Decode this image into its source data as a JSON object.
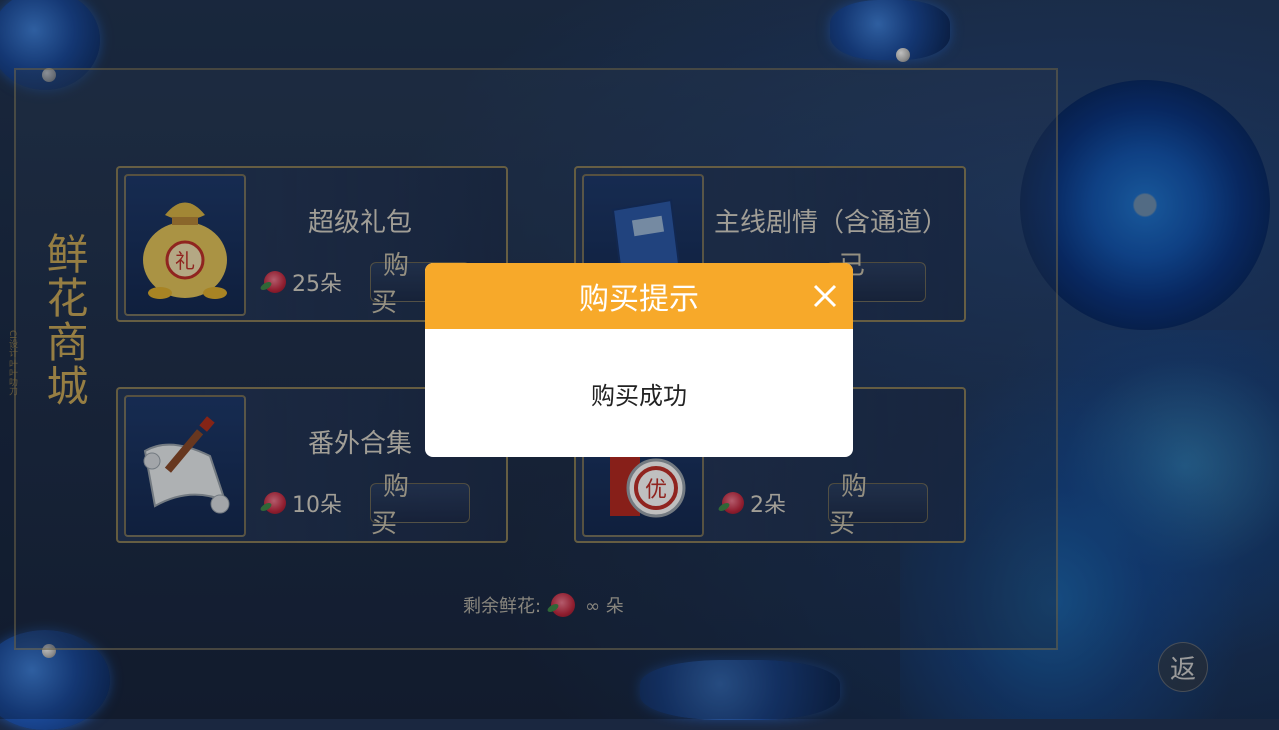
{
  "title": "鲜花商城",
  "subtitle": "CI设计 叶叶叻刀",
  "products": [
    {
      "name": "超级礼包",
      "price": "25朵",
      "button": "购买",
      "icon": "gift-bag-icon"
    },
    {
      "name": "主线剧情（含通道）",
      "price": "",
      "button": "已购",
      "icon": "book-icon"
    },
    {
      "name": "番外合集",
      "price": "10朵",
      "button": "购买",
      "icon": "scroll-icon"
    },
    {
      "name": "",
      "price": "2朵",
      "button": "购买",
      "icon": "discount-badge-icon"
    }
  ],
  "remaining": {
    "label": "剩余鲜花:",
    "value": "∞ 朵"
  },
  "dialog": {
    "title": "购买提示",
    "message": "购买成功"
  },
  "corner_button": "返",
  "colors": {
    "dialog_header": "#f7a92a",
    "gold": "#c9a85a",
    "background": "#1a2740"
  }
}
